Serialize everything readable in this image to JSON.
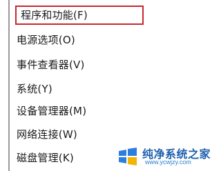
{
  "menu": {
    "items": [
      {
        "label": "程序和功能(F)"
      },
      {
        "label": "电源选项(O)"
      },
      {
        "label": "事件查看器(V)"
      },
      {
        "label": "系统(Y)"
      },
      {
        "label": "设备管理器(M)"
      },
      {
        "label": "网络连接(W)"
      },
      {
        "label": "磁盘管理(K)"
      }
    ],
    "highlight_color": "#c8262c"
  },
  "watermark": {
    "title": "纯净系统之家",
    "url": "www.ycwjzy.com",
    "brand_color": "#1d5fae"
  }
}
